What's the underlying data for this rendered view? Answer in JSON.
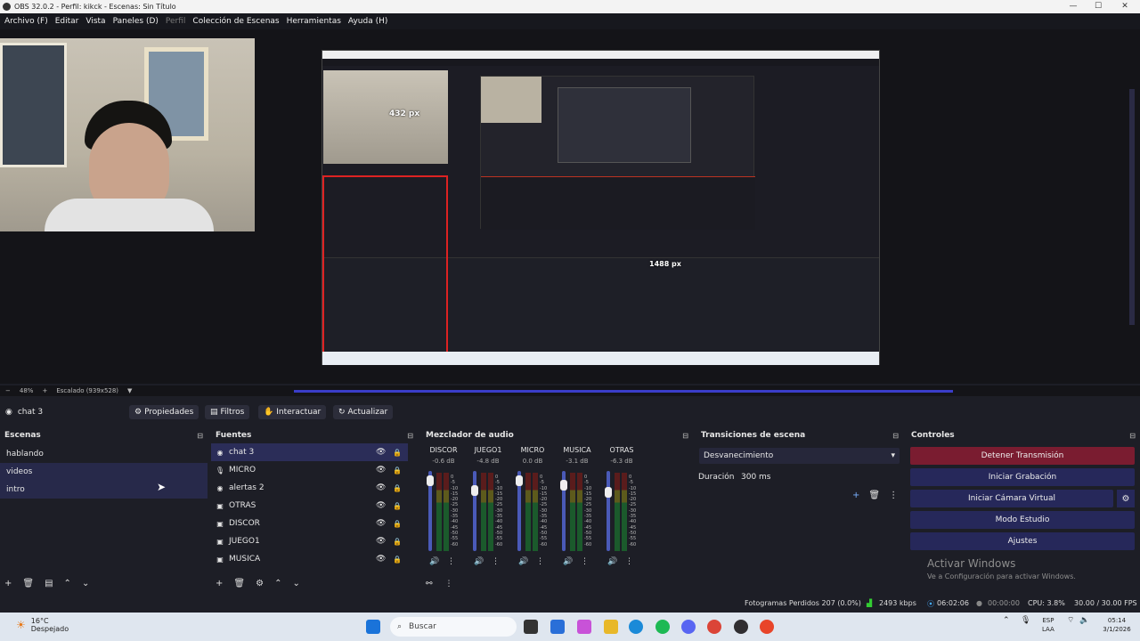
{
  "window": {
    "title": "OBS 32.0.2 - Perfil: kikck - Escenas: Sin Título",
    "minimize": "—",
    "maximize": "☐",
    "close": "✕"
  },
  "menu": [
    "Archivo (F)",
    "Editar",
    "Vista",
    "Paneles (D)",
    "Perfil",
    "Colección de Escenas",
    "Herramientas",
    "Ayuda (H)"
  ],
  "preview": {
    "px_label_1": "432 px",
    "px_label_2": "1488 px",
    "zoom": "48%",
    "scale_mode": "Escalado (939x528)"
  },
  "context": {
    "source": "chat 3",
    "buttons": [
      "Propiedades",
      "Filtros",
      "Interactuar",
      "Actualizar"
    ]
  },
  "scenes": {
    "title": "Escenas",
    "items": [
      "hablando",
      "videos",
      "intro"
    ]
  },
  "sources": {
    "title": "Fuentes",
    "items": [
      {
        "name": "chat 3",
        "icon": "globe-icon"
      },
      {
        "name": "MICRO",
        "icon": "mic-icon"
      },
      {
        "name": "alertas 2",
        "icon": "globe-icon"
      },
      {
        "name": "OTRAS",
        "icon": "audio-capture-icon"
      },
      {
        "name": "DISCOR",
        "icon": "audio-capture-icon"
      },
      {
        "name": "JUEGO1",
        "icon": "audio-capture-icon"
      },
      {
        "name": "MUSICA",
        "icon": "audio-capture-icon"
      }
    ]
  },
  "mixer": {
    "title": "Mezclador de audio",
    "channels": [
      {
        "name": "DISCOR",
        "db": "-0.6 dB"
      },
      {
        "name": "JUEGO1",
        "db": "-4.8 dB"
      },
      {
        "name": "MICRO",
        "db": "0.0 dB"
      },
      {
        "name": "MUSICA",
        "db": "-3.1 dB"
      },
      {
        "name": "OTRAS",
        "db": "-6.3 dB"
      }
    ],
    "scale": [
      "0",
      "-5",
      "-10",
      "-15",
      "-20",
      "-25",
      "-30",
      "-35",
      "-40",
      "-45",
      "-50",
      "-55",
      "-60"
    ]
  },
  "transitions": {
    "title": "Transiciones de escena",
    "selected": "Desvanecimiento",
    "duration_label": "Duración",
    "duration_value": "300 ms"
  },
  "controls": {
    "title": "Controles",
    "buttons": [
      "Detener Transmisión",
      "Iniciar Grabación",
      "Iniciar Cámara Virtual",
      "Modo Estudio",
      "Ajustes"
    ]
  },
  "watermark": {
    "line1": "Activar Windows",
    "line2": "Ve a Configuración para activar Windows."
  },
  "status": {
    "dropped": "Fotogramas Perdidos 207 (0.0%)",
    "bitrate": "2493 kbps",
    "live_time": "06:02:06",
    "rec_time": "00:00:00",
    "cpu": "CPU: 3.8%",
    "fps": "30.00 / 30.00 FPS"
  },
  "taskbar": {
    "temp": "16°C",
    "weather": "Despejado",
    "search": "Buscar",
    "lang1": "ESP",
    "lang2": "LAA",
    "time": "05:14",
    "date": "3/1/2026"
  },
  "colors": {
    "accent": "#2b2d58",
    "stream_red": "#7a1c30",
    "selection_red": "#dd2222"
  }
}
